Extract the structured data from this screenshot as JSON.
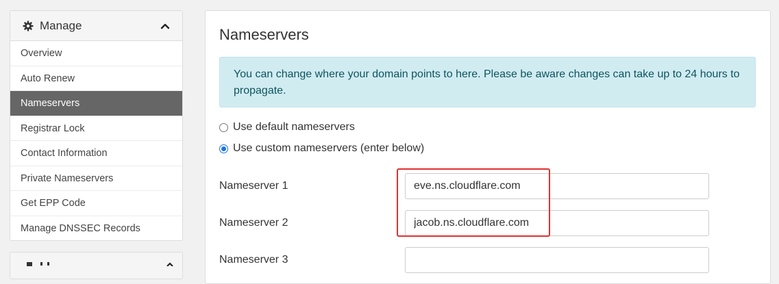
{
  "sidebar": {
    "title": "Manage",
    "items": [
      {
        "label": "Overview",
        "active": false
      },
      {
        "label": "Auto Renew",
        "active": false
      },
      {
        "label": "Nameservers",
        "active": true
      },
      {
        "label": "Registrar Lock",
        "active": false
      },
      {
        "label": "Contact Information",
        "active": false
      },
      {
        "label": "Private Nameservers",
        "active": false
      },
      {
        "label": "Get EPP Code",
        "active": false
      },
      {
        "label": "Manage DNSSEC Records",
        "active": false
      }
    ]
  },
  "main": {
    "title": "Nameservers",
    "alert": "You can change where your domain points to here. Please be aware changes can take up to 24 hours to propagate.",
    "radio_default": {
      "label": "Use default nameservers",
      "checked": false
    },
    "radio_custom": {
      "label": "Use custom nameservers (enter below)",
      "checked": true
    },
    "nameservers": [
      {
        "label": "Nameserver 1",
        "value": "eve.ns.cloudflare.com"
      },
      {
        "label": "Nameserver 2",
        "value": "jacob.ns.cloudflare.com"
      },
      {
        "label": "Nameserver 3",
        "value": ""
      }
    ]
  },
  "colors": {
    "active_item_bg": "#666666",
    "alert_bg": "#d1ecf1",
    "alert_text": "#0c5460",
    "highlight_border": "#e03030",
    "radio_checked": "#1a73e8"
  },
  "icons": {
    "sidebar_header_icon": "gear-icon",
    "collapse_icon": "chevron-up-icon"
  }
}
